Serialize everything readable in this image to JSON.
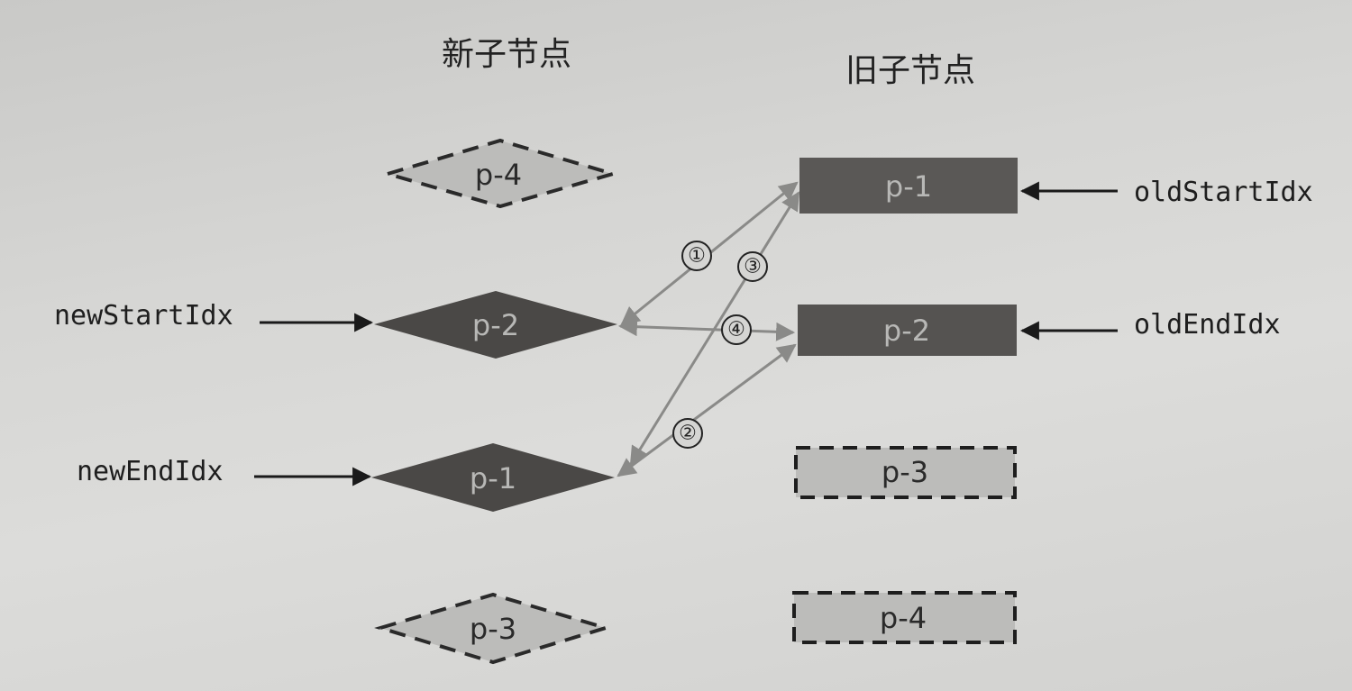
{
  "headings": {
    "new": "新子节点",
    "old": "旧子节点"
  },
  "pointers": {
    "new_start": "newStartIdx",
    "new_end": "newEndIdx",
    "old_start": "oldStartIdx",
    "old_end": "oldEndIdx"
  },
  "new_nodes": [
    {
      "label": "p-4",
      "style": "dashed"
    },
    {
      "label": "p-2",
      "style": "solid"
    },
    {
      "label": "p-1",
      "style": "solid"
    },
    {
      "label": "p-3",
      "style": "dashed"
    }
  ],
  "old_nodes": [
    {
      "label": "p-1",
      "style": "solid"
    },
    {
      "label": "p-2",
      "style": "solid"
    },
    {
      "label": "p-3",
      "style": "dashed"
    },
    {
      "label": "p-4",
      "style": "dashed"
    }
  ],
  "comparisons": [
    {
      "step": "①",
      "from": "new p-2",
      "to": "old p-1"
    },
    {
      "step": "②",
      "from": "new p-1",
      "to": "old p-2"
    },
    {
      "step": "③",
      "from": "new p-1",
      "to": "old p-1"
    },
    {
      "step": "④",
      "from": "new p-2",
      "to": "old p-2"
    }
  ],
  "colors": {
    "solid_fill": "#4a4846",
    "dashed_fill": "#bcbcba",
    "solid_text": "#b8b8b6",
    "dashed_text": "#2a2a2a",
    "arrow_gray": "#8a8a88",
    "pointer_arrow": "#1a1a1a"
  }
}
